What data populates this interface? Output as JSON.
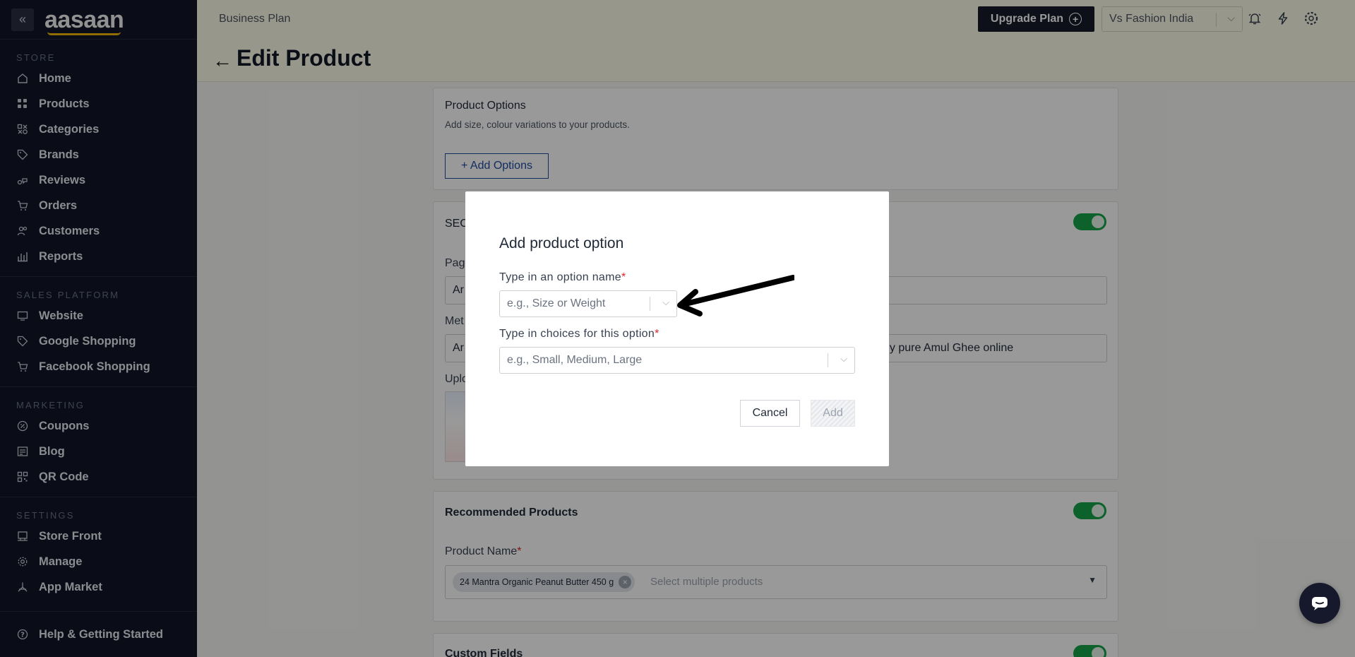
{
  "sidebar": {
    "logo": "aasaan",
    "sections": {
      "store": "STORE",
      "sales_platform": "SALES PLATFORM",
      "marketing": "MARKETING",
      "settings": "SETTINGS"
    },
    "store_items": [
      "Home",
      "Products",
      "Categories",
      "Brands",
      "Reviews",
      "Orders",
      "Customers",
      "Reports"
    ],
    "sales_items": [
      "Website",
      "Google Shopping",
      "Facebook Shopping"
    ],
    "marketing_items": [
      "Coupons",
      "Blog",
      "QR Code"
    ],
    "settings_items": [
      "Store Front",
      "Manage",
      "App Market"
    ],
    "help": "Help & Getting Started"
  },
  "header": {
    "plan": "Business Plan",
    "upgrade_label": "Upgrade Plan",
    "store_name": "Vs Fashion India"
  },
  "page": {
    "title": "Edit Product"
  },
  "product_options": {
    "title": "Product Options",
    "subtitle": "Add size, colour variations to your products.",
    "add_button": "+ Add Options"
  },
  "seo": {
    "title_partial": "SEO",
    "page_label_partial": "Pag",
    "page_value_partial": "Ar",
    "meta_label_partial": "Met",
    "meta_value_partial": "Ar",
    "meta_value_tail": "uy pure Amul Ghee online",
    "upload_label_partial": "Uplo"
  },
  "recommended": {
    "title": "Recommended Products",
    "field_label": "Product Name",
    "required_mark": "*",
    "chip": "24 Mantra Organic Peanut Butter 450 g",
    "placeholder": "Select multiple products"
  },
  "custom_fields": {
    "title": "Custom Fields"
  },
  "modal": {
    "title": "Add product option",
    "name_label": "Type in an option name",
    "name_placeholder": "e.g., Size or Weight",
    "choices_label": "Type in choices for this option",
    "choices_placeholder": "e.g., Small, Medium, Large",
    "required_mark": "*",
    "cancel": "Cancel",
    "add": "Add"
  }
}
